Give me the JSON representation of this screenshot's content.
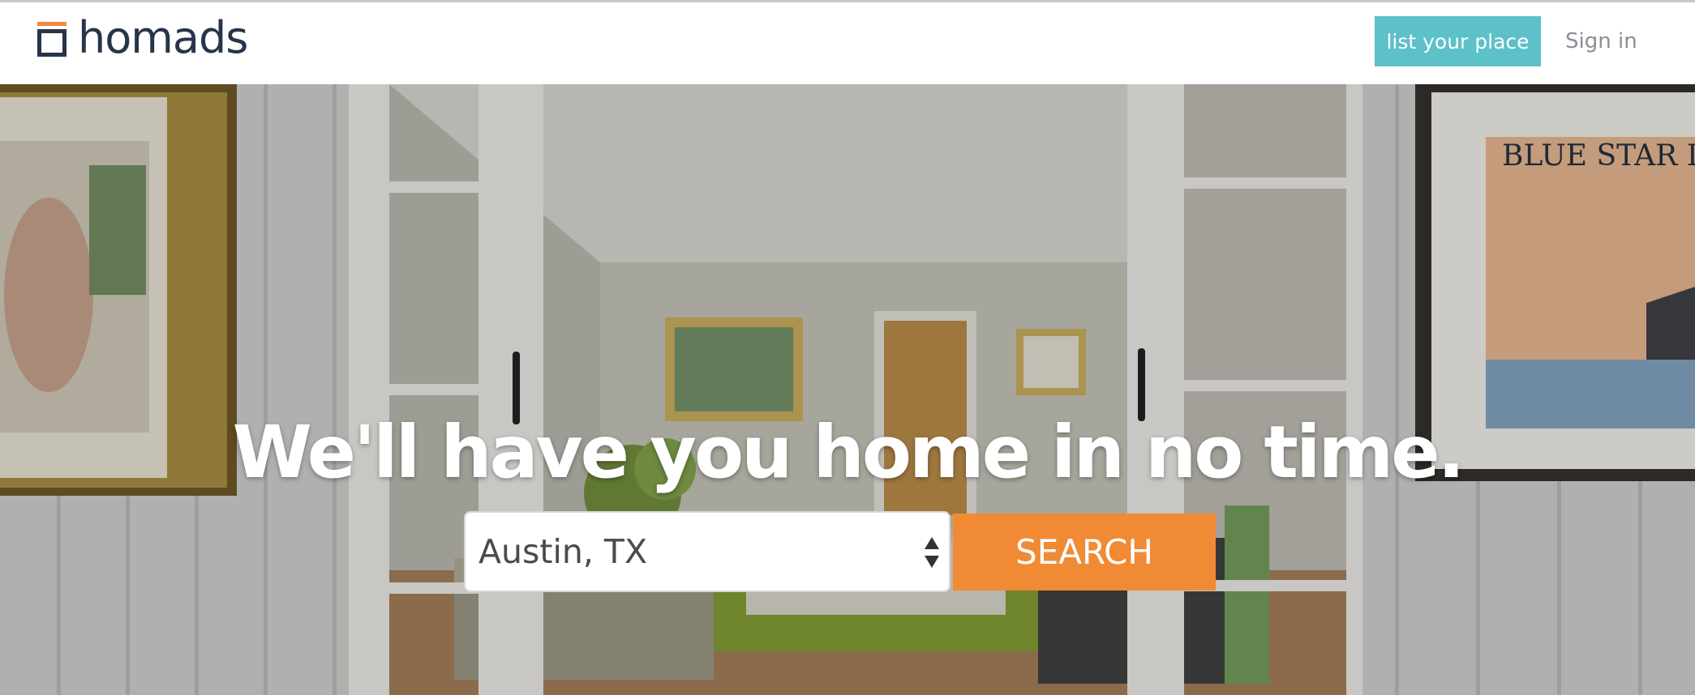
{
  "header": {
    "brand": "homads",
    "list_place_label": "list your place",
    "sign_in_label": "Sign in"
  },
  "hero": {
    "headline": "We'll have you home in no time.",
    "location_value": "Austin, TX",
    "search_label": "SEARCH",
    "poster_text": "BLUE STAR L"
  },
  "colors": {
    "brand_accent": "#f08a3a",
    "brand_text": "#27344a",
    "teal_button": "#5cc1c8",
    "search_button": "#f08a34"
  },
  "icons": [
    "logo-mark",
    "select-arrows-icon"
  ]
}
